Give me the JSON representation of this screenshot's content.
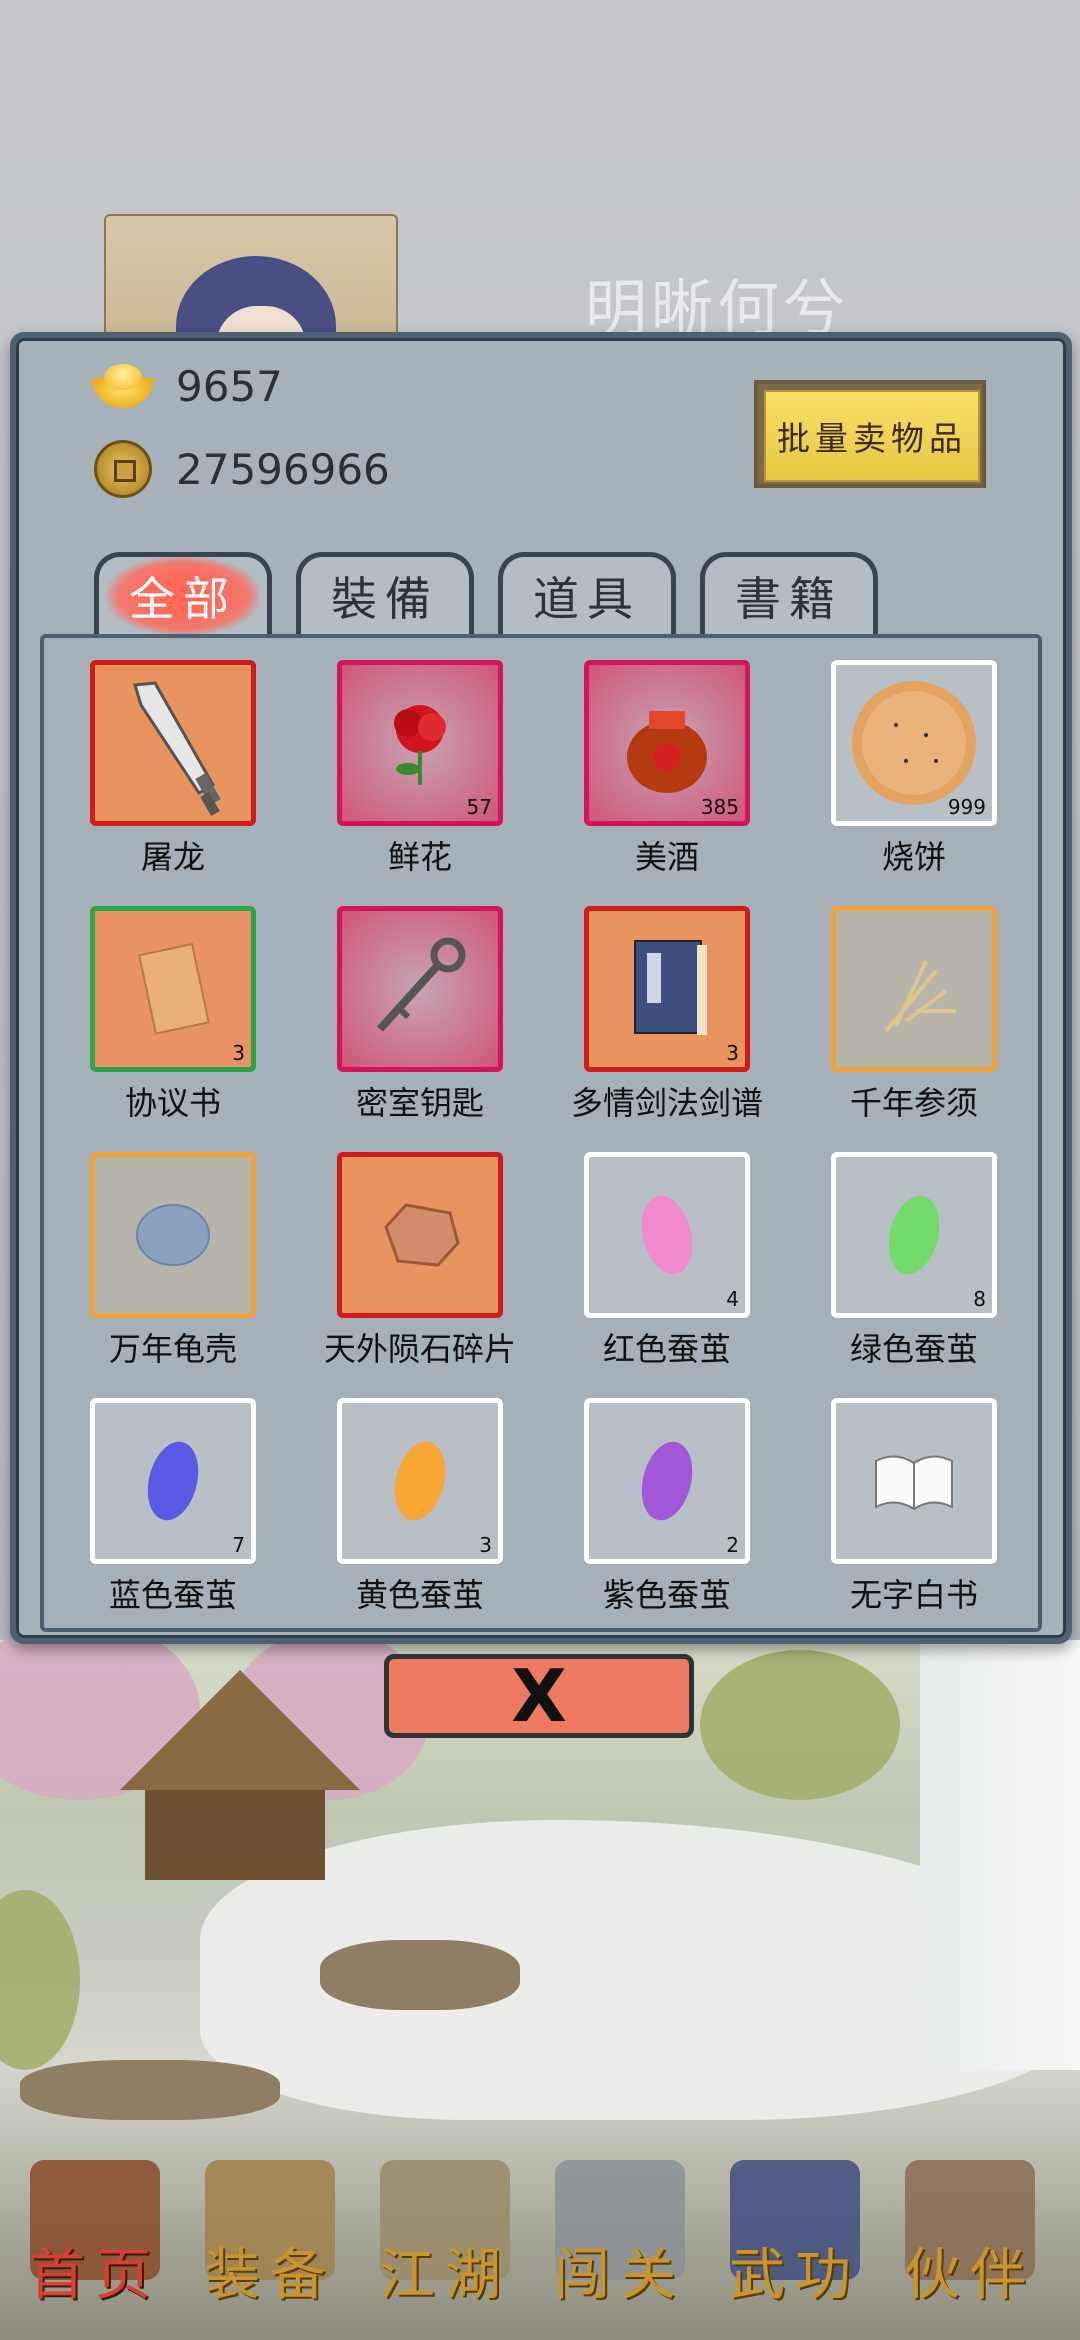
{
  "background": {
    "character_name": "明晰何兮"
  },
  "currency": {
    "gold": "9657",
    "copper": "27596966"
  },
  "sell_button_label": "批量卖物品",
  "tabs": [
    {
      "label": "全部",
      "active": true
    },
    {
      "label": "裝備",
      "active": false
    },
    {
      "label": "道具",
      "active": false
    },
    {
      "label": "書籍",
      "active": false
    }
  ],
  "items": [
    {
      "name": "屠龙",
      "count": "",
      "rarity": "red",
      "icon": "sword-icon"
    },
    {
      "name": "鲜花",
      "count": "57",
      "rarity": "pink",
      "icon": "rose-icon"
    },
    {
      "name": "美酒",
      "count": "385",
      "rarity": "pink",
      "icon": "wine-jar-icon"
    },
    {
      "name": "烧饼",
      "count": "999",
      "rarity": "white",
      "icon": "flatbread-icon"
    },
    {
      "name": "协议书",
      "count": "3",
      "rarity": "green",
      "icon": "contract-icon"
    },
    {
      "name": "密室钥匙",
      "count": "",
      "rarity": "pink",
      "icon": "key-icon"
    },
    {
      "name": "多情剑法剑谱",
      "count": "3",
      "rarity": "red",
      "icon": "manual-book-icon"
    },
    {
      "name": "千年参须",
      "count": "",
      "rarity": "orange",
      "icon": "ginseng-icon"
    },
    {
      "name": "万年龟壳",
      "count": "",
      "rarity": "orange",
      "icon": "tortoise-shell-icon"
    },
    {
      "name": "天外陨石碎片",
      "count": "",
      "rarity": "red",
      "icon": "meteorite-icon"
    },
    {
      "name": "红色蚕茧",
      "count": "4",
      "rarity": "white",
      "icon": "red-cocoon-icon"
    },
    {
      "name": "绿色蚕茧",
      "count": "8",
      "rarity": "white",
      "icon": "green-cocoon-icon"
    },
    {
      "name": "蓝色蚕茧",
      "count": "7",
      "rarity": "white",
      "icon": "blue-cocoon-icon"
    },
    {
      "name": "黄色蚕茧",
      "count": "3",
      "rarity": "white",
      "icon": "yellow-cocoon-icon"
    },
    {
      "name": "紫色蚕茧",
      "count": "2",
      "rarity": "white",
      "icon": "purple-cocoon-icon"
    },
    {
      "name": "无字白书",
      "count": "",
      "rarity": "white",
      "icon": "blank-book-icon"
    }
  ],
  "close_button_label": "X",
  "nav": [
    {
      "label": "首页",
      "active": true,
      "icon": "house-icon"
    },
    {
      "label": "装备",
      "active": false,
      "icon": "armor-icon"
    },
    {
      "label": "江湖",
      "active": false,
      "icon": "scroll-icon"
    },
    {
      "label": "闯关",
      "active": false,
      "icon": "crossed-swords-icon"
    },
    {
      "label": "武功",
      "active": false,
      "icon": "martial-book-icon"
    },
    {
      "label": "伙伴",
      "active": false,
      "icon": "partners-icon"
    }
  ],
  "colors": {
    "rarity_red": "#d21a1a",
    "rarity_pink": "#d4145a",
    "rarity_green": "#2ca546",
    "rarity_orange": "#f0a13a",
    "rarity_white": "#ffffff",
    "nav_active": "#d64030",
    "nav_inactive": "#c7952b"
  }
}
